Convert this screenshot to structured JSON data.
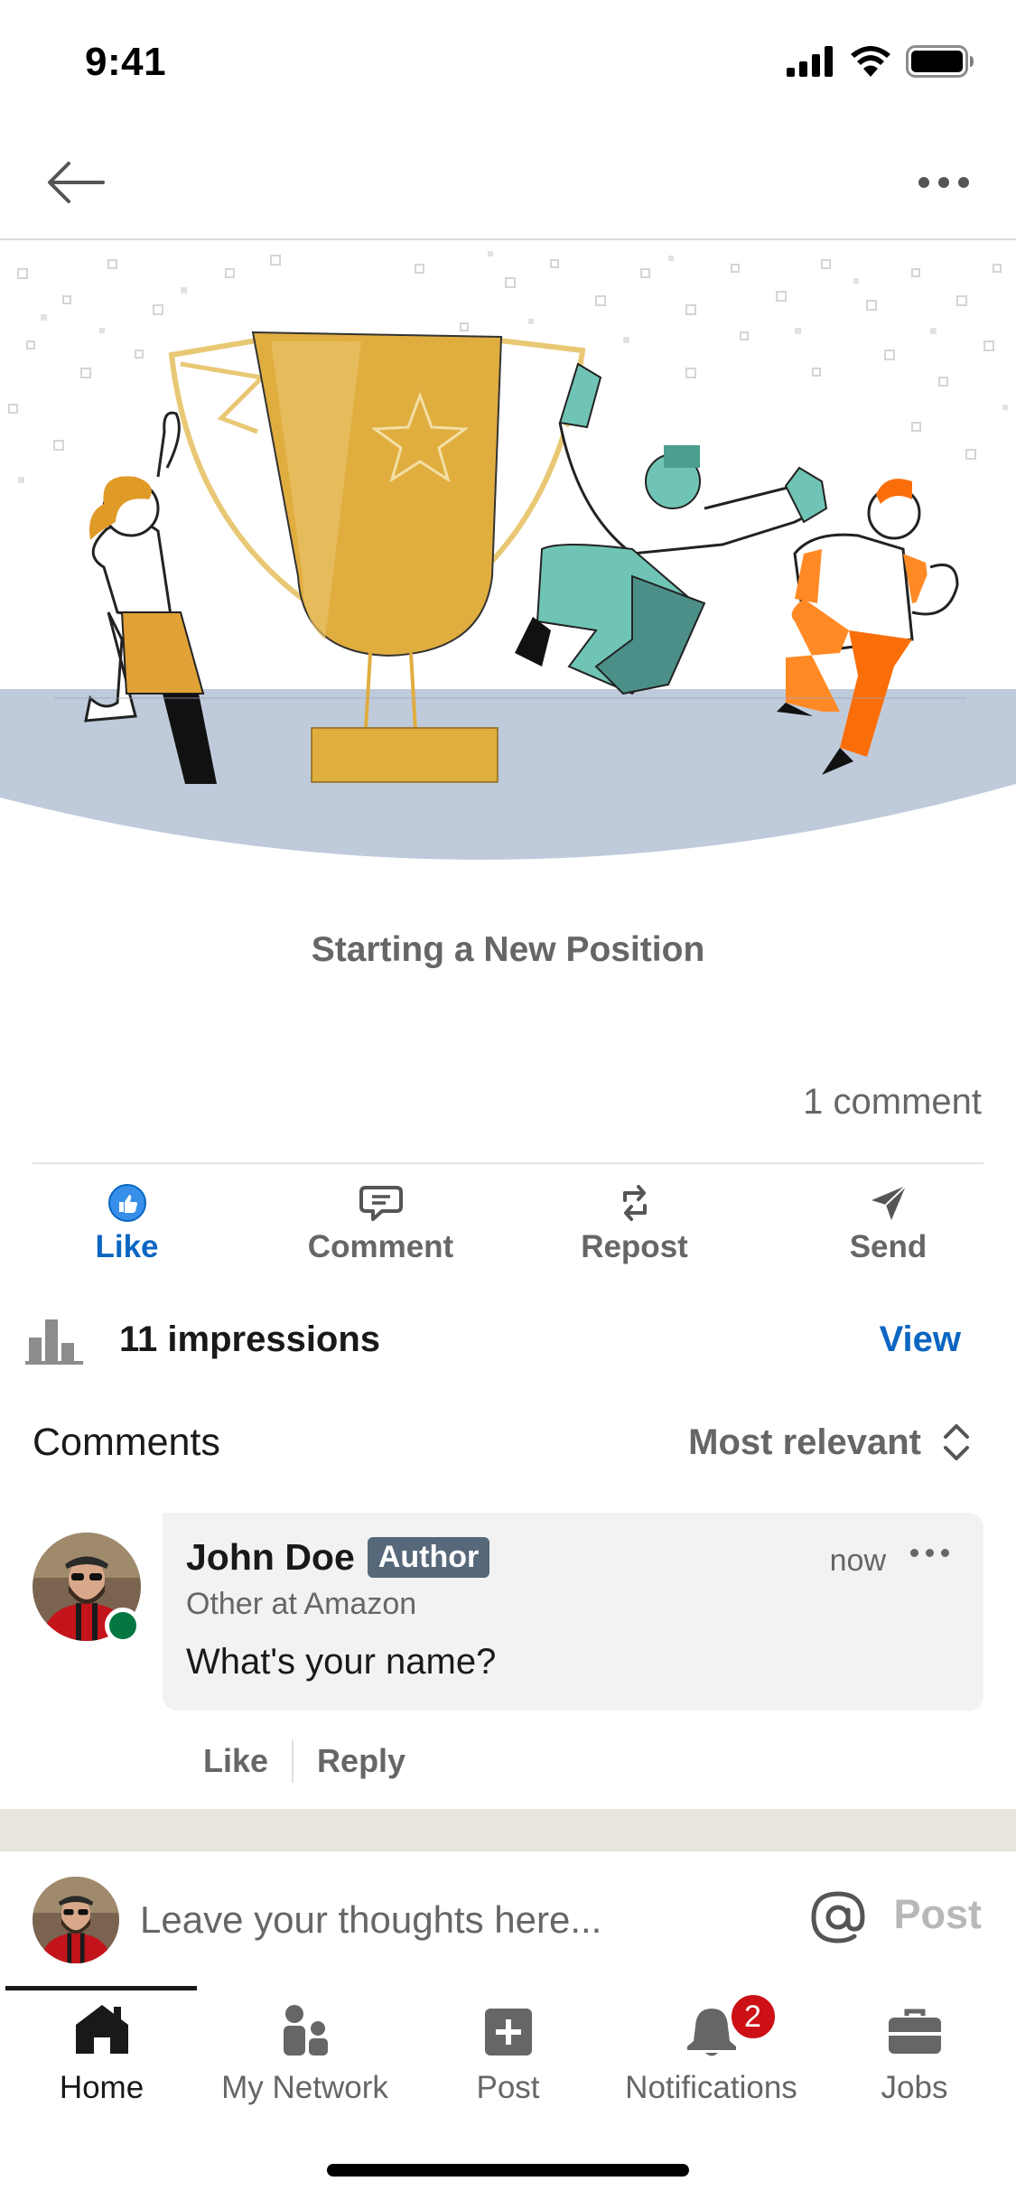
{
  "status_bar": {
    "time": "9:41"
  },
  "event": {
    "title": "Starting a New Position"
  },
  "stats": {
    "comment_count": "1 comment"
  },
  "actions": [
    {
      "label": "Like",
      "icon": "like-icon"
    },
    {
      "label": "Comment",
      "icon": "comment-icon"
    },
    {
      "label": "Repost",
      "icon": "repost-icon"
    },
    {
      "label": "Send",
      "icon": "send-icon"
    }
  ],
  "impressions": {
    "text": "11 impressions",
    "view_label": "View"
  },
  "comments_section": {
    "title": "Comments",
    "sort_label": "Most relevant"
  },
  "comment": {
    "name": "John Doe",
    "badge": "Author",
    "time": "now",
    "subtitle": "Other at Amazon",
    "text": "What's your name?",
    "like_label": "Like",
    "reply_label": "Reply"
  },
  "composer": {
    "placeholder": "Leave your thoughts here...",
    "post_label": "Post"
  },
  "tabs": [
    {
      "label": "Home",
      "icon": "home-icon",
      "active": true
    },
    {
      "label": "My Network",
      "icon": "network-icon"
    },
    {
      "label": "Post",
      "icon": "add-post-icon"
    },
    {
      "label": "Notifications",
      "icon": "bell-icon",
      "badge": "2"
    },
    {
      "label": "Jobs",
      "icon": "briefcase-icon"
    }
  ],
  "colors": {
    "accent": "#0a66c2",
    "text_secondary": "#666666",
    "author_badge": "#56687a",
    "notification_badge": "#cc1016",
    "online": "#057642"
  }
}
